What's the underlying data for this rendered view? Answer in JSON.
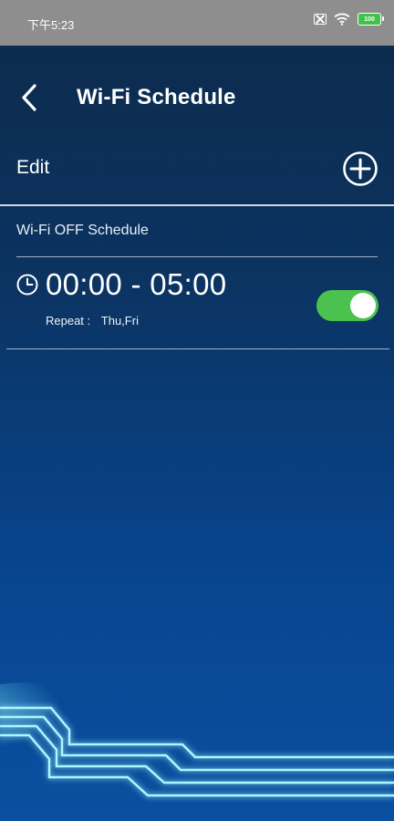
{
  "status_bar": {
    "time": "下午5:23",
    "icons": [
      "sim-icon",
      "wifi-icon",
      "battery-icon"
    ],
    "battery": "100"
  },
  "header": {
    "title": "Wi-Fi Schedule",
    "back_icon": "chevron-left-icon"
  },
  "edit_row": {
    "label": "Edit",
    "add_icon": "plus-circle-icon"
  },
  "section": {
    "title": "Wi-Fi OFF Schedule"
  },
  "schedules": [
    {
      "time_range": "00:00 - 05:00",
      "repeat_label": "Repeat :",
      "repeat_days": "Thu,Fri",
      "enabled": true,
      "clock_icon": "clock-icon"
    }
  ],
  "colors": {
    "background_top": "#0c2a4a",
    "background_bottom": "#0a4fa0",
    "status_bar": "#8e8e8e",
    "toggle_on": "#4cc24e",
    "glow": "#7ff3ff"
  }
}
